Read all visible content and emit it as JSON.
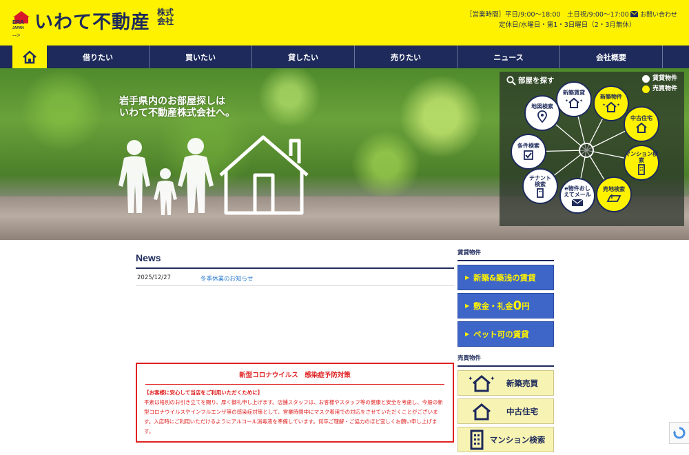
{
  "brand": {
    "era": "ERA",
    "japan": "JAPAN",
    "arrow": "-->",
    "name": "いわて不動産",
    "suffix": "株式会社"
  },
  "header": {
    "hours_line1": "［営業時間］平日/9:00〜18:00　土日祝/9:00〜17:00",
    "hours_line2": "定休日/水曜日・第1・3日曜日（2・3月無休）",
    "contact_label": "お問い合わせ"
  },
  "nav": {
    "home_icon": "home-icon",
    "items": [
      "借りたい",
      "買いたい",
      "貸したい",
      "売りたい",
      "ニュース",
      "会社概要"
    ]
  },
  "hero": {
    "copy_line1": "岩手県内のお部屋探しは",
    "copy_line2": "いわて不動産株式会社へ。"
  },
  "search_panel": {
    "title": "部屋を探す",
    "legend_rent": "賃貸物件",
    "legend_buy": "売買物件",
    "rent_color": "#ffffff",
    "buy_color": "#fff200",
    "nodes": [
      {
        "label": "新築賃貸",
        "type": "rent",
        "icon": "sparkle-house-icon"
      },
      {
        "label": "新築物件",
        "type": "buy",
        "icon": "sparkle-house-icon"
      },
      {
        "label": "中古住宅",
        "type": "buy",
        "icon": "house-icon"
      },
      {
        "label": "マンション検索",
        "type": "buy",
        "icon": "building-icon"
      },
      {
        "label": "売地検索",
        "type": "buy",
        "icon": "land-icon"
      },
      {
        "label": "e物件おしえてメール",
        "type": "rent",
        "icon": "mail-icon"
      },
      {
        "label": "テナント検索",
        "type": "rent",
        "icon": "building-icon"
      },
      {
        "label": "条件検索",
        "type": "rent",
        "icon": "checkbox-icon"
      },
      {
        "label": "地図検索",
        "type": "rent",
        "icon": "map-pin-icon"
      }
    ]
  },
  "news": {
    "title": "News",
    "items": [
      {
        "date": "2025/12/27",
        "text": "冬季休業のお知らせ"
      }
    ]
  },
  "notice": {
    "title": "新型コロナウイルス　感染症予防対策",
    "subtitle": "【お客様に安心して当店をご利用いただくために】",
    "body": "平素は格別のお引き立てを賜り、厚く御礼申し上げます。店舗スタッフは、お客様やスタッフ等の健康と安全を考慮し、今般の新型コロナウイルスやインフルエンザ等の感染症対策として、営業時間中にマスク着用での対応をさせていただくことがございます。入店時にご利用いただけるようにアルコール消毒液を準備しています。何卒ご理解・ご協力のほど宜しくお願い申し上げます。"
  },
  "sidebar": {
    "rent_heading": "賃貸物件",
    "rent_buttons": [
      {
        "label": "新築&築浅の賃貸"
      },
      {
        "label_a": "敷金・礼金",
        "label_big": "0",
        "label_b": "円"
      },
      {
        "label": "ペット可の賃貸"
      }
    ],
    "buy_heading": "売買物件",
    "buy_buttons": [
      {
        "label": "新築売買",
        "icon": "sparkle-house-icon"
      },
      {
        "label": "中古住宅",
        "icon": "house-icon"
      },
      {
        "label": "マンション検索",
        "icon": "building-icon"
      }
    ]
  },
  "colors": {
    "brand_yellow": "#fff200",
    "brand_navy": "#1d2a5b",
    "notice_red": "#e02020",
    "rent_blue": "#3e66c8",
    "news_link": "#2a7ad0"
  }
}
